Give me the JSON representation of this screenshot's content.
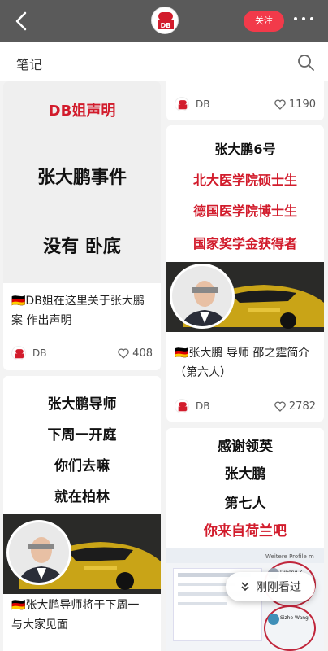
{
  "header": {
    "follow_label": "关注",
    "logo_text": "DB"
  },
  "section": {
    "title": "笔记"
  },
  "cards": [
    {
      "poster_lines": [
        {
          "text": "DB姐声明",
          "color": "#d21c2c"
        },
        {
          "text": "张大鹏事件",
          "color": "#111111"
        },
        {
          "text": "没有 卧底",
          "color": "#111111"
        }
      ],
      "title": "🇩🇪DB姐在这里关于张大鹏案 作出声明",
      "author": "DB",
      "likes": "408"
    },
    {
      "title": "",
      "author": "DB",
      "likes": "1190"
    },
    {
      "poster_lines": [
        {
          "text": "张大鹏6号",
          "color": "#111111"
        },
        {
          "text": "北大医学院硕士生",
          "color": "#d21c2c"
        },
        {
          "text": "德国医学院博士生",
          "color": "#d21c2c"
        },
        {
          "text": "国家奖学金获得者",
          "color": "#d21c2c"
        }
      ],
      "title": "🇩🇪张大鹏 导师 邵之霆简介（第六人）",
      "author": "DB",
      "likes": "2782"
    },
    {
      "poster_lines": [
        {
          "text": "张大鹏导师",
          "color": "#111111"
        },
        {
          "text": "下周一开庭",
          "color": "#111111"
        },
        {
          "text": "你们去嘛",
          "color": "#111111"
        },
        {
          "text": "就在柏林",
          "color": "#111111"
        }
      ],
      "title": "🇩🇪张大鹏导师将于下周一 与大家见面"
    },
    {
      "poster_lines": [
        {
          "text": "感谢领英",
          "color": "#111111"
        },
        {
          "text": "张大鹏",
          "color": "#111111"
        },
        {
          "text": "第七人",
          "color": "#111111"
        },
        {
          "text": "你来自荷兰吧",
          "color": "#d21c2c"
        }
      ],
      "screenshot_text": {
        "name_1": "Dipeng Z.",
        "name_2": "Sizhe Wang",
        "banner": "Weitere Profile m"
      }
    }
  ],
  "recently_viewed": {
    "label": "刚刚看过"
  },
  "colors": {
    "accent": "#f23a4a",
    "topbar": "#5a5a5a",
    "poster_red": "#d21c2c"
  }
}
